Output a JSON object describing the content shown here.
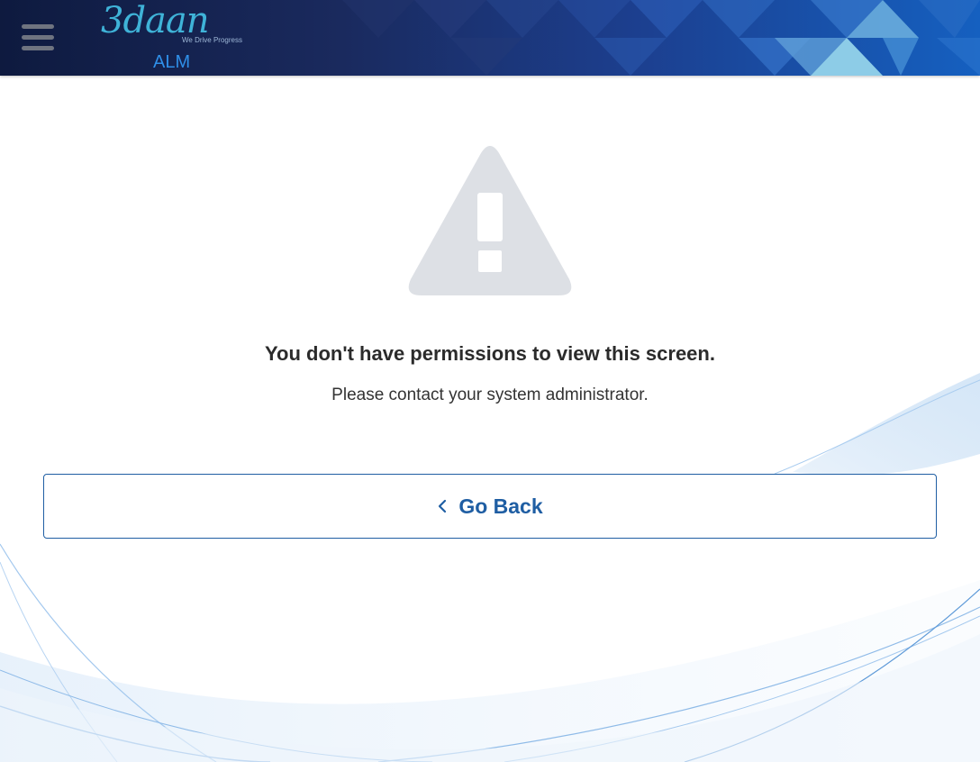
{
  "header": {
    "logo_text": "3daan",
    "logo_tagline": "We Drive Progress",
    "app_name": "ALM",
    "menu_icon": "hamburger-menu-icon",
    "colors": {
      "header_dark": "#0e1a3f",
      "header_light": "#1560c0",
      "logo": "#3fb3d8",
      "app_name": "#2f8fe8"
    }
  },
  "main": {
    "icon": "warning-triangle-icon",
    "icon_color": "#dde0e5",
    "title": "You don't have permissions to view this screen.",
    "subtitle": "Please contact your system administrator.",
    "back_button": {
      "icon": "chevron-left-icon",
      "label": "Go Back",
      "color": "#1f5ea3"
    }
  }
}
